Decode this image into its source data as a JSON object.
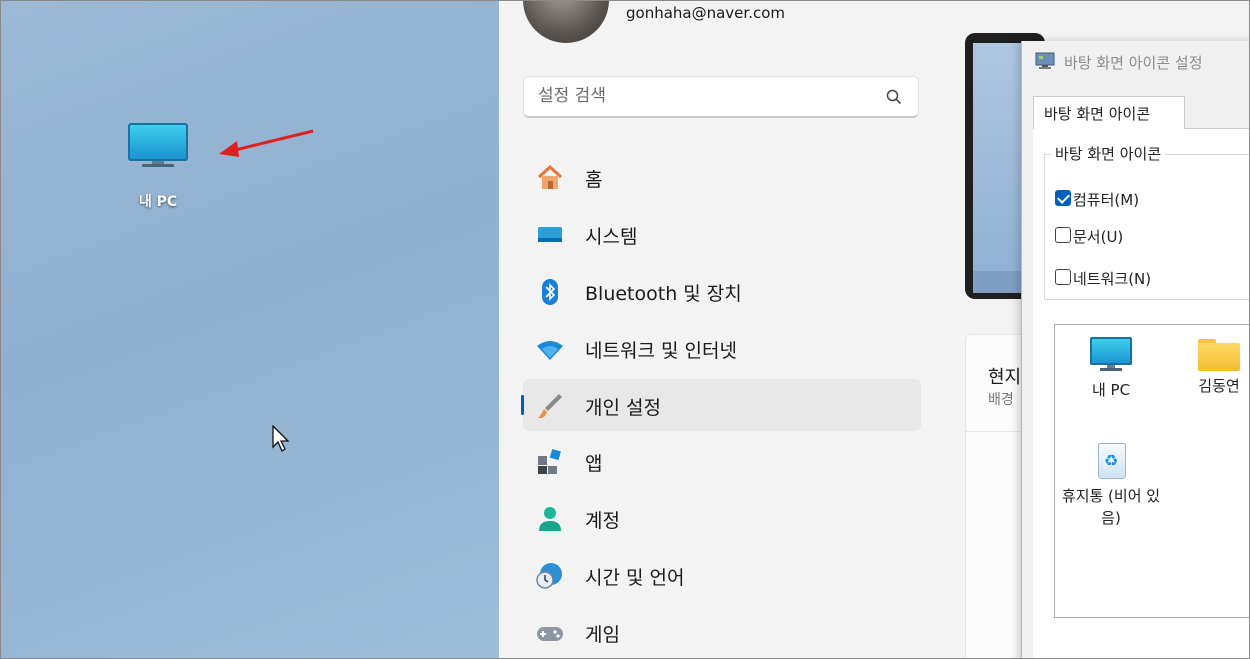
{
  "desktop": {
    "icon_label": "내 PC"
  },
  "settings": {
    "account_email": "gonhaha@naver.com",
    "search_placeholder": "설정 검색",
    "nav": [
      {
        "label": "홈",
        "icon": "home-icon"
      },
      {
        "label": "시스템",
        "icon": "system-icon"
      },
      {
        "label": "Bluetooth 및 장치",
        "icon": "bluetooth-icon"
      },
      {
        "label": "네트워크 및 인터넷",
        "icon": "wifi-icon"
      },
      {
        "label": "개인 설정",
        "icon": "brush-icon",
        "active": true
      },
      {
        "label": "앱",
        "icon": "apps-icon"
      },
      {
        "label": "계정",
        "icon": "account-icon"
      },
      {
        "label": "시간 및 언어",
        "icon": "clock-globe-icon"
      },
      {
        "label": "게임",
        "icon": "gamepad-icon"
      }
    ],
    "card": {
      "title": "현지",
      "subtitle": "배경"
    },
    "accent_color": "#005fb8"
  },
  "dialog": {
    "title": "바탕 화면 아이콘 설정",
    "tab": "바탕 화면 아이콘",
    "group_title": "바탕 화면 아이콘",
    "checkboxes": [
      {
        "label": "컴퓨터(M)",
        "checked": true
      },
      {
        "label": "문서(U)",
        "checked": false
      },
      {
        "label": "네트워크(N)",
        "checked": false
      }
    ],
    "icons": [
      {
        "label": "내 PC"
      },
      {
        "label": "김동연"
      },
      {
        "label": "휴지통 (비어 있음)"
      }
    ]
  }
}
